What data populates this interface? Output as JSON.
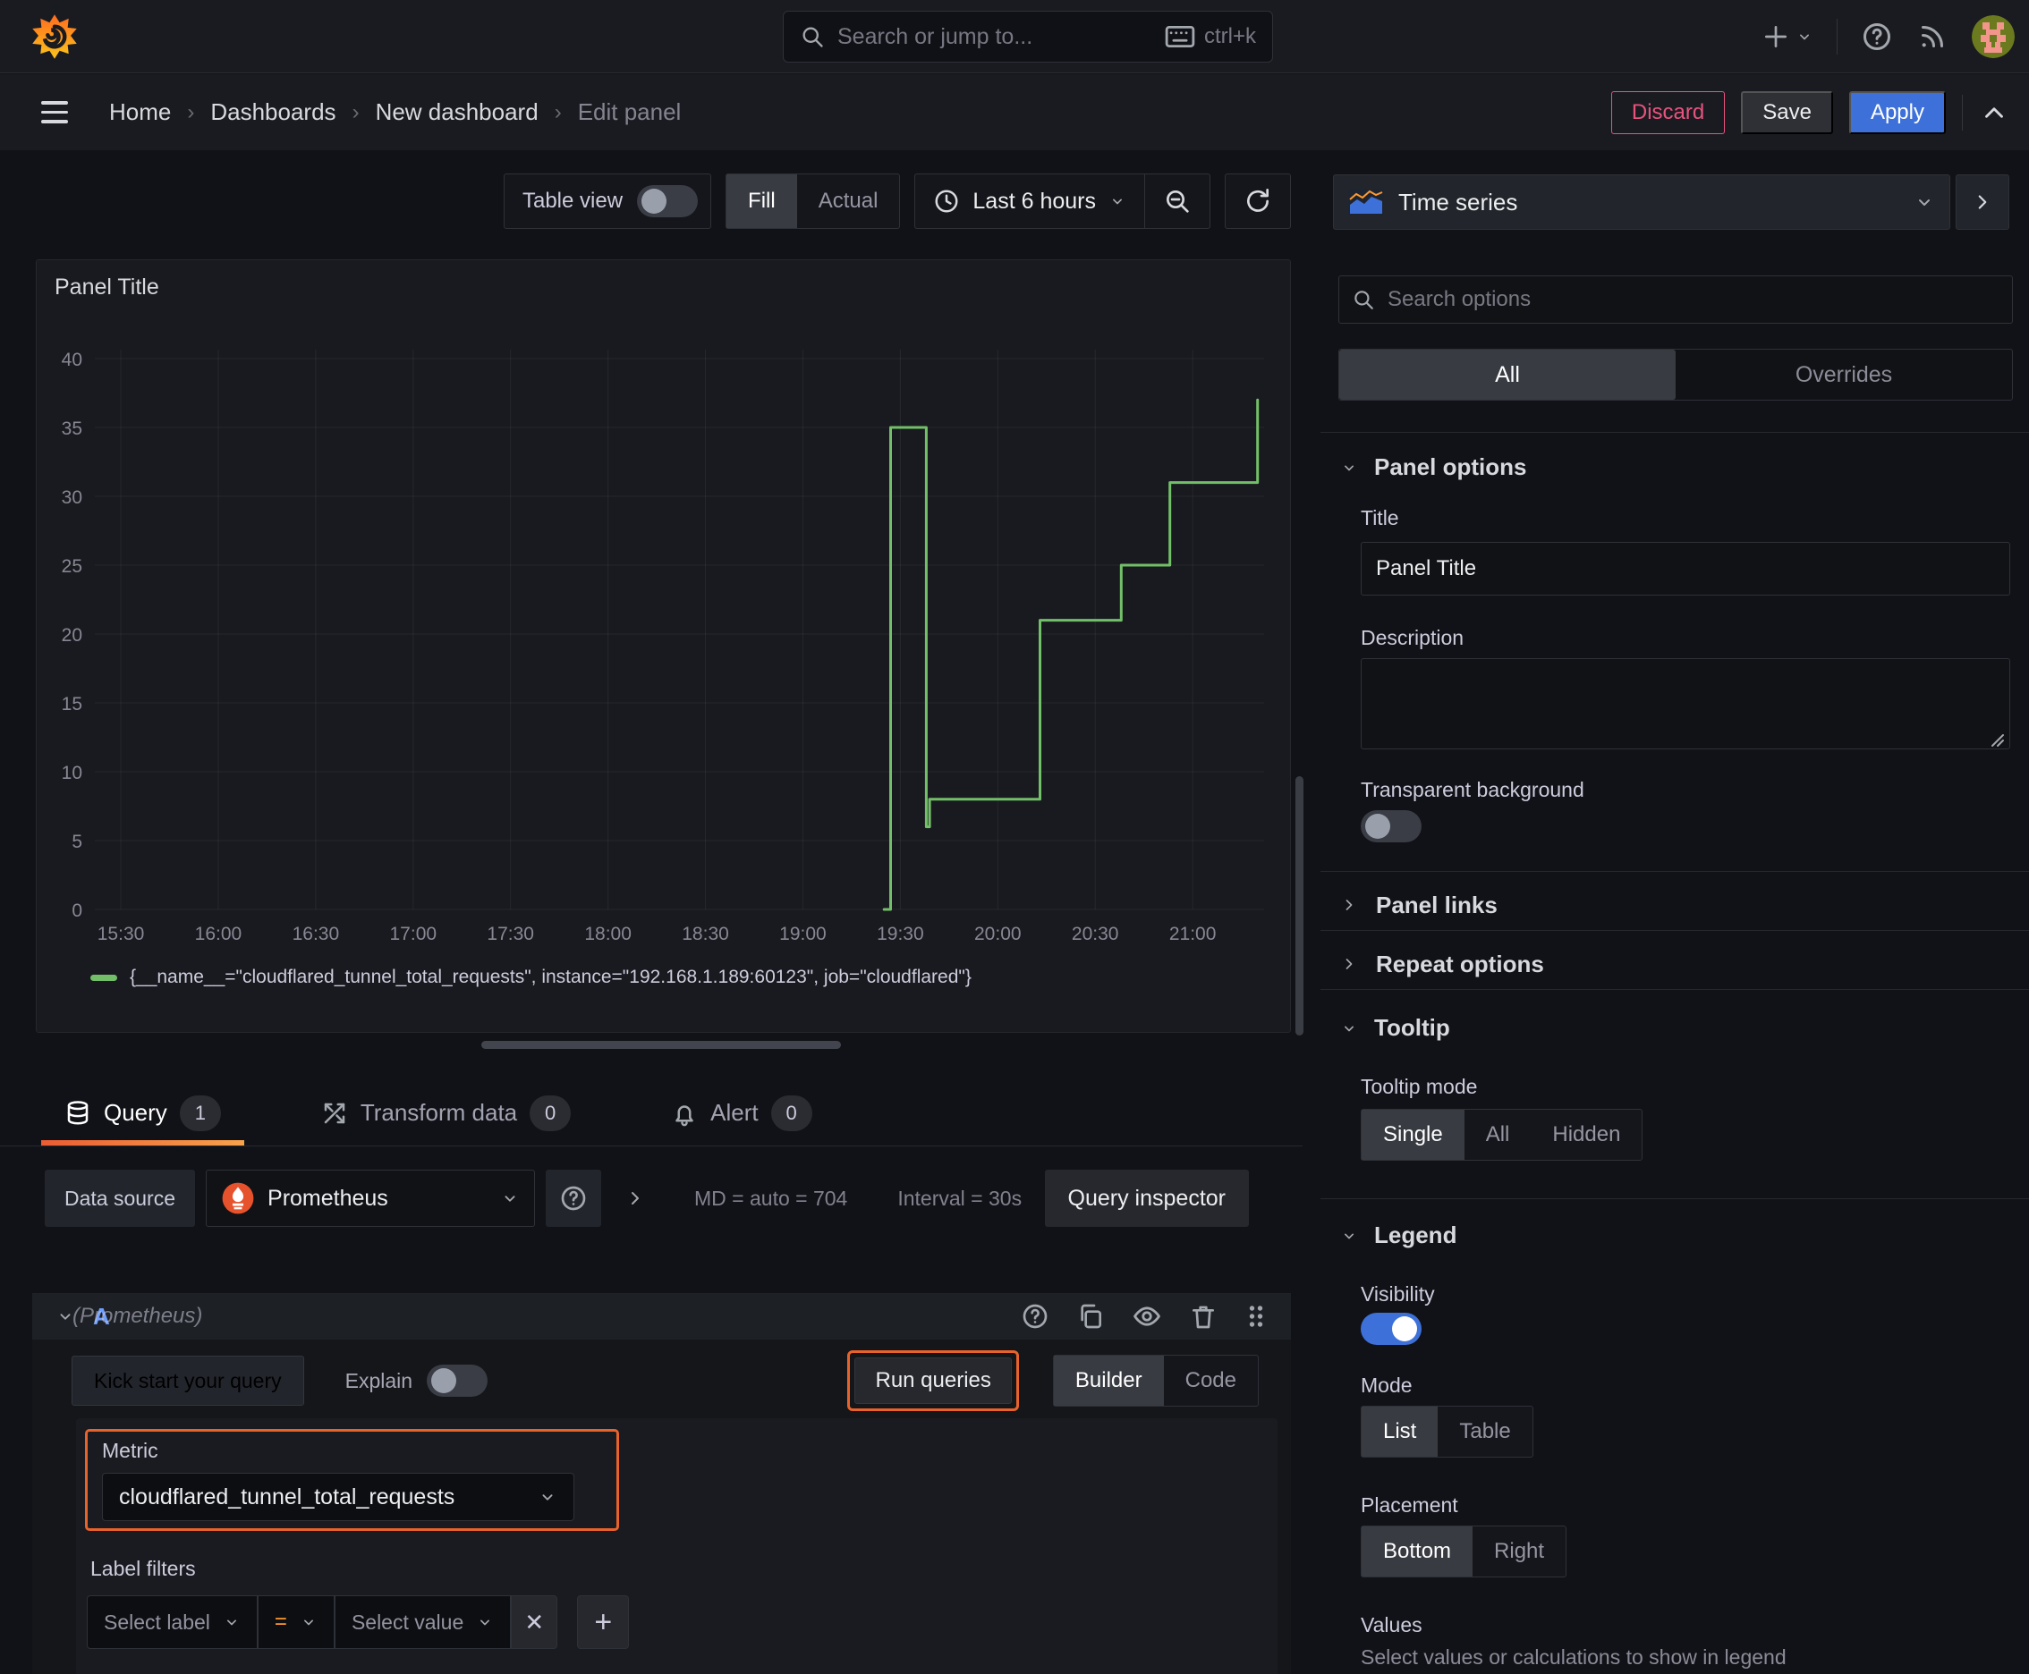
{
  "topnav": {
    "search_placeholder": "Search or jump to...",
    "search_shortcut": "ctrl+k"
  },
  "breadcrumb": [
    "Home",
    "Dashboards",
    "New dashboard",
    "Edit panel"
  ],
  "header_actions": {
    "discard": "Discard",
    "save": "Save",
    "apply": "Apply"
  },
  "toolbar": {
    "table_view_label": "Table view",
    "fill_label": "Fill",
    "actual_label": "Actual",
    "time_range_label": "Last 6 hours"
  },
  "panel": {
    "title": "Panel Title",
    "legend_item": "{__name__=\"cloudflared_tunnel_total_requests\", instance=\"192.168.1.189:60123\", job=\"cloudflared\"}"
  },
  "chart_data": {
    "type": "line",
    "line_style": "step-after",
    "title": "Panel Title",
    "x_domain": [
      "15:22",
      "21:22"
    ],
    "x_ticks": [
      "15:30",
      "16:00",
      "16:30",
      "17:00",
      "17:30",
      "18:00",
      "18:30",
      "19:00",
      "19:30",
      "20:00",
      "20:30",
      "21:00"
    ],
    "ylim": [
      0,
      40
    ],
    "y_ticks": [
      0,
      5,
      10,
      15,
      20,
      25,
      30,
      35,
      40
    ],
    "grid": true,
    "legend_position": "bottom",
    "series": [
      {
        "name": "{__name__=\"cloudflared_tunnel_total_requests\", instance=\"192.168.1.189:60123\", job=\"cloudflared\"}",
        "color": "#73bf69",
        "points": [
          [
            "19:25",
            0
          ],
          [
            "19:27",
            35
          ],
          [
            "19:38",
            6
          ],
          [
            "19:39",
            8
          ],
          [
            "20:13",
            21
          ],
          [
            "20:38",
            25
          ],
          [
            "20:53",
            31
          ],
          [
            "21:20",
            37
          ]
        ]
      }
    ]
  },
  "editor_tabs": [
    {
      "label": "Query",
      "count": "1",
      "icon": "database-icon",
      "active": true
    },
    {
      "label": "Transform data",
      "count": "0",
      "icon": "transform-icon",
      "active": false
    },
    {
      "label": "Alert",
      "count": "0",
      "icon": "bell-icon",
      "active": false
    }
  ],
  "query_editor": {
    "datasource_label": "Data source",
    "datasource_value": "Prometheus",
    "stats_md": "MD = auto = 704",
    "stats_interval": "Interval = 30s",
    "inspector_label": "Query inspector",
    "ref_id": "A",
    "ref_hint": "(Prometheus)",
    "kickstart_label": "Kick start your query",
    "explain_label": "Explain",
    "run_label": "Run queries",
    "builder_label": "Builder",
    "code_label": "Code",
    "metric_label": "Metric",
    "metric_value": "cloudflared_tunnel_total_requests",
    "label_filters_label": "Label filters",
    "select_label_placeholder": "Select label",
    "operator": "=",
    "select_value_placeholder": "Select value"
  },
  "sidebar": {
    "visualization": "Time series",
    "search_placeholder": "Search options",
    "filter_tabs": {
      "all": "All",
      "overrides": "Overrides",
      "active": "All"
    },
    "panel_options": {
      "title": "Panel options",
      "title_label": "Title",
      "title_value": "Panel Title",
      "description_label": "Description",
      "transparent_label": "Transparent background",
      "transparent_on": false,
      "panel_links": "Panel links",
      "repeat_options": "Repeat options"
    },
    "tooltip": {
      "title": "Tooltip",
      "mode_label": "Tooltip mode",
      "modes": [
        "Single",
        "All",
        "Hidden"
      ],
      "active_mode": "Single"
    },
    "legend": {
      "title": "Legend",
      "visibility_label": "Visibility",
      "visibility_on": true,
      "mode_label": "Mode",
      "modes": [
        "List",
        "Table"
      ],
      "active_mode": "List",
      "placement_label": "Placement",
      "placements": [
        "Bottom",
        "Right"
      ],
      "active_placement": "Bottom",
      "values_label": "Values",
      "values_hint": "Select values or calculations to show in legend"
    }
  },
  "colors": {
    "accent_orange": "#e8632c",
    "tab_gradient_start": "#eb5c33",
    "tab_gradient_end": "#f8a24c",
    "apply_blue": "#3d71d9",
    "discard_pink": "#e8537e",
    "series_green": "#73bf69"
  }
}
